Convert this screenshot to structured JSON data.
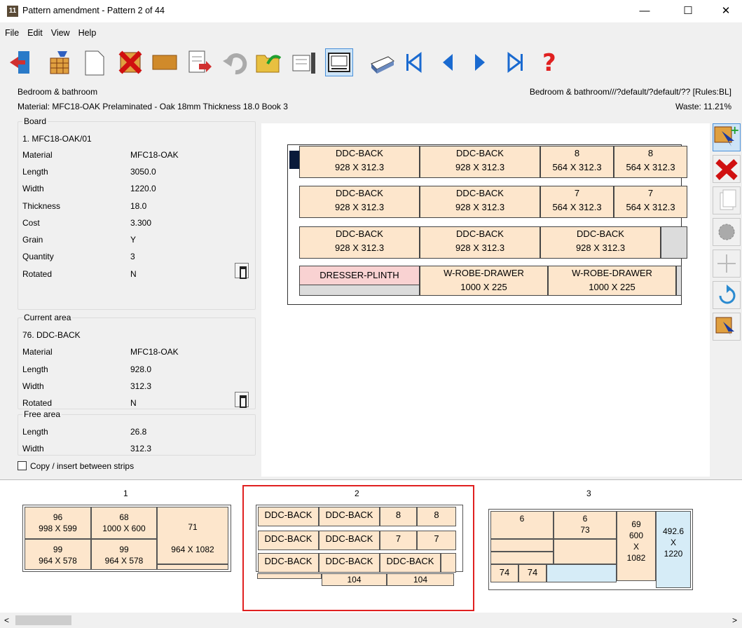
{
  "window": {
    "title": "Pattern amendment - Pattern 2 of 44",
    "app_icon": "11",
    "minimize": "—",
    "maximize": "☐",
    "close": "✕"
  },
  "menu": [
    "File",
    "Edit",
    "View",
    "Help"
  ],
  "toolbar": [
    "exit-icon",
    "board-edit-icon",
    "new-page-icon",
    "delete-icon",
    "material-icon",
    "import-icon",
    "undo-icon",
    "open-folder-icon",
    "report-icon",
    "layout-icon",
    "print-icon",
    "first-icon",
    "previous-icon",
    "next-icon",
    "last-icon",
    "help-icon"
  ],
  "header": {
    "left1": "Bedroom & bathroom",
    "right1": "Bedroom & bathroom///?default/?default/?? [Rules:BL]",
    "left2": "Material: MFC18-OAK Prelaminated - Oak 18mm Thickness 18.0 Book 3",
    "right2": "Waste: 11.21%"
  },
  "board": {
    "legend": "Board",
    "id": "1. MFC18-OAK/01",
    "rows": [
      [
        "Material",
        "MFC18-OAK"
      ],
      [
        "Length",
        "3050.0"
      ],
      [
        "Width",
        "1220.0"
      ],
      [
        "Thickness",
        "18.0"
      ],
      [
        "Cost",
        "3.300"
      ],
      [
        "Grain",
        "Y"
      ],
      [
        "Quantity",
        "3"
      ],
      [
        "Rotated",
        "N"
      ]
    ]
  },
  "current": {
    "legend": "Current area",
    "id": "76. DDC-BACK",
    "rows": [
      [
        "Material",
        "MFC18-OAK"
      ],
      [
        "Length",
        "928.0"
      ],
      [
        "Width",
        "312.3"
      ],
      [
        "Rotated",
        "N"
      ]
    ]
  },
  "free": {
    "legend": "Free area",
    "rows": [
      [
        "Length",
        "26.8"
      ],
      [
        "Width",
        "312.3"
      ]
    ]
  },
  "copy_label": "Copy / insert between strips",
  "pattern": [
    {
      "l1": "DDC-BACK",
      "l2": "928 X 312.3"
    },
    {
      "l1": "DDC-BACK",
      "l2": "928 X 312.3"
    },
    {
      "l1": "8",
      "l2": "564 X 312.3"
    },
    {
      "l1": "8",
      "l2": "564 X 312.3"
    },
    {
      "l1": "DDC-BACK",
      "l2": "928 X 312.3"
    },
    {
      "l1": "DDC-BACK",
      "l2": "928 X 312.3"
    },
    {
      "l1": "7",
      "l2": "564 X 312.3"
    },
    {
      "l1": "7",
      "l2": "564 X 312.3"
    },
    {
      "l1": "DDC-BACK",
      "l2": "928 X 312.3"
    },
    {
      "l1": "DDC-BACK",
      "l2": "928 X 312.3"
    },
    {
      "l1": "DDC-BACK",
      "l2": "928 X 312.3"
    },
    {
      "l1": "DRESSER-PLINTH",
      "l2": ""
    },
    {
      "l1": "W-ROBE-DRAWER",
      "l2": "1000 X 225"
    },
    {
      "l1": "W-ROBE-DRAWER",
      "l2": "1000 X 225"
    }
  ],
  "sidebar": [
    "add-part-icon",
    "delete-part-icon",
    "copy-icon",
    "saw-icon",
    "move-icon",
    "rotate-icon",
    "select-part-icon"
  ],
  "thumbs": {
    "t1": {
      "label": "1",
      "cells": [
        [
          "96",
          "998 X 599"
        ],
        [
          "68",
          "1000 X 600"
        ],
        [
          "71",
          ""
        ],
        [
          "99",
          "964 X 578"
        ],
        [
          "99",
          "964 X 578"
        ],
        [
          "964 X 1082",
          ""
        ]
      ]
    },
    "t2": {
      "label": "2",
      "cells": [
        "DDC-BACK",
        "DDC-BACK",
        "8",
        "8",
        "DDC-BACK",
        "DDC-BACK",
        "7",
        "7",
        "DDC-BACK",
        "DDC-BACK",
        "DDC-BACK",
        "104",
        "104"
      ]
    },
    "t3": {
      "label": "3",
      "cells": [
        "6",
        "6",
        "73",
        "69",
        "600",
        "X",
        "1082",
        "492.6",
        "X",
        "1220",
        "74",
        "74"
      ]
    }
  },
  "colors": {
    "part": "#fde6cc",
    "plinth": "#f9d2d2",
    "waste": "#dcdcdc",
    "selected_frame": "#e02020",
    "offcut": "#d6ecf7"
  }
}
